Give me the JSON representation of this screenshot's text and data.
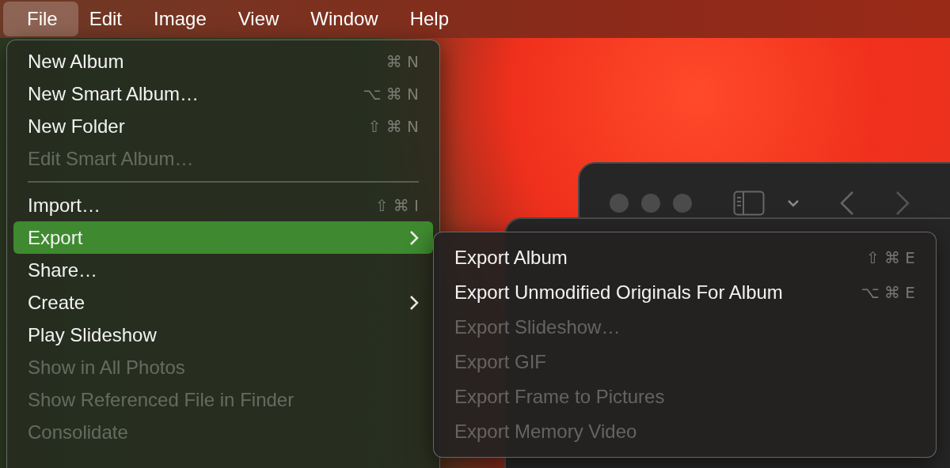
{
  "menu_bar": [
    {
      "label": "File",
      "selected": true
    },
    {
      "label": "Edit",
      "selected": false
    },
    {
      "label": "Image",
      "selected": false
    },
    {
      "label": "View",
      "selected": false
    },
    {
      "label": "Window",
      "selected": false
    },
    {
      "label": "Help",
      "selected": false
    }
  ],
  "file_menu": [
    {
      "kind": "item",
      "label": "New Album",
      "shortcut": "⌘ N",
      "disabled": false,
      "selected": false,
      "submenu": false
    },
    {
      "kind": "item",
      "label": "New Smart Album…",
      "shortcut": "⌥ ⌘ N",
      "disabled": false,
      "selected": false,
      "submenu": false
    },
    {
      "kind": "item",
      "label": "New Folder",
      "shortcut": "⇧ ⌘ N",
      "disabled": false,
      "selected": false,
      "submenu": false
    },
    {
      "kind": "item",
      "label": "Edit Smart Album…",
      "disabled": true,
      "selected": false,
      "submenu": false
    },
    {
      "kind": "separator"
    },
    {
      "kind": "item",
      "label": "Import…",
      "shortcut": "⇧ ⌘ I",
      "disabled": false,
      "selected": false,
      "submenu": false
    },
    {
      "kind": "item",
      "label": "Export",
      "disabled": false,
      "selected": true,
      "submenu": true
    },
    {
      "kind": "item",
      "label": "Share…",
      "disabled": false,
      "selected": false,
      "submenu": false
    },
    {
      "kind": "item",
      "label": "Create",
      "disabled": false,
      "selected": false,
      "submenu": true
    },
    {
      "kind": "item",
      "label": "Play Slideshow",
      "disabled": false,
      "selected": false,
      "submenu": false
    },
    {
      "kind": "item",
      "label": "Show in All Photos",
      "disabled": true,
      "selected": false,
      "submenu": false
    },
    {
      "kind": "item",
      "label": "Show Referenced File in Finder",
      "disabled": true,
      "selected": false,
      "submenu": false
    },
    {
      "kind": "item",
      "label": "Consolidate",
      "disabled": true,
      "selected": false,
      "submenu": false
    }
  ],
  "export_submenu": [
    {
      "label": "Export Album",
      "shortcut": "⇧ ⌘ E",
      "disabled": false
    },
    {
      "label": "Export Unmodified Originals For Album",
      "shortcut": "⌥ ⌘ E",
      "disabled": false
    },
    {
      "label": "Export Slideshow…",
      "disabled": true
    },
    {
      "label": "Export GIF",
      "disabled": true
    },
    {
      "label": "Export Frame to Pictures",
      "disabled": true
    },
    {
      "label": "Export Memory Video",
      "disabled": true
    }
  ]
}
